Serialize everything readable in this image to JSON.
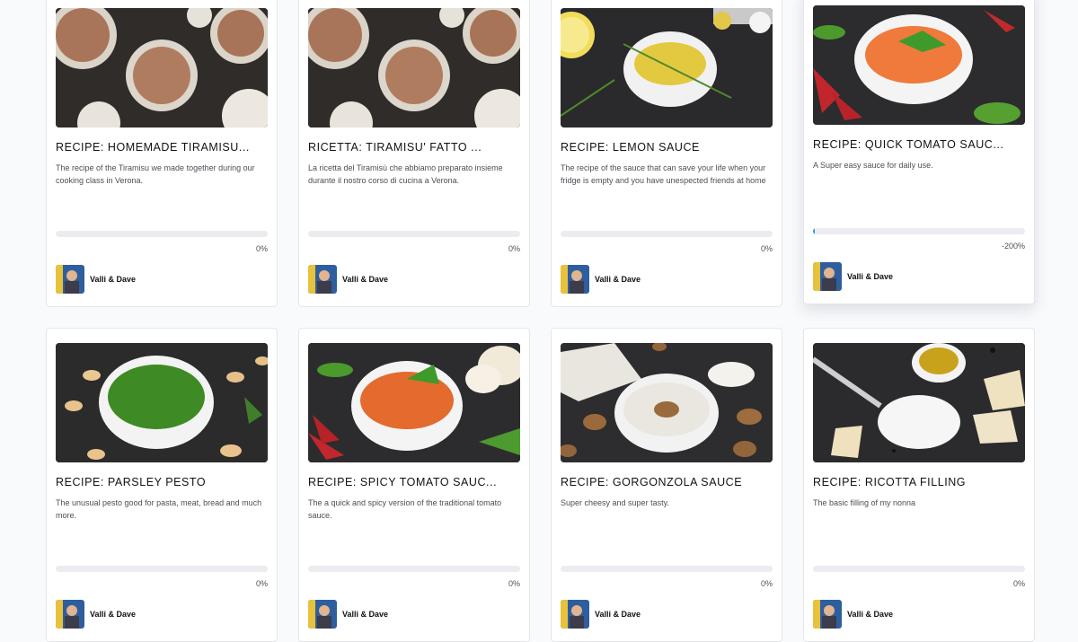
{
  "author": "Valli & Dave",
  "colors": {
    "progress_track": "#ececf0",
    "progress_fill": "#1f9ee8",
    "card_border": "#e4e6eb"
  },
  "recipes": [
    {
      "title": "RECIPE: HOMEMADE TIRAMISU...",
      "description": "The recipe of the Tiramisu we made together during our cooking class in Verona.",
      "progress_label": "0%",
      "progress_value": 0,
      "image": "tiramisu-jars"
    },
    {
      "title": "RICETTA: TIRAMISU' FATTO ...",
      "description": "La ricetta del Tiramisù che abbiamo preparato insieme durante il nostro corso di cucina a Verona.",
      "progress_label": "0%",
      "progress_value": 0,
      "image": "tiramisu-jars"
    },
    {
      "title": "RECIPE: LEMON SAUCE",
      "description": "The recipe of the sauce that can save your life when your fridge is empty and you have unespected friends at home",
      "progress_label": "0%",
      "progress_value": 0,
      "image": "lemon-sauce-bowl"
    },
    {
      "title": "RECIPE: QUICK TOMATO SAUC...",
      "description": "A Super easy sauce for daily use.",
      "progress_label": "-200%",
      "progress_value": -2,
      "image": "tomato-sauce-bowl"
    },
    {
      "title": "RECIPE: PARSLEY PESTO",
      "description": "The unusual pesto good for pasta, meat, bread and much more.",
      "progress_label": "0%",
      "progress_value": 0,
      "image": "parsley-pesto-bowl"
    },
    {
      "title": "RECIPE: SPICY TOMATO SAUC...",
      "description": "The a quick and spicy version of the traditional tomato sauce.",
      "progress_label": "0%",
      "progress_value": 0,
      "image": "spicy-tomato-bowl"
    },
    {
      "title": "RECIPE: GORGONZOLA SAUCE",
      "description": "Super cheesy and super tasty.",
      "progress_label": "0%",
      "progress_value": 0,
      "image": "gorgonzola-sauce-bowl"
    },
    {
      "title": "RECIPE: RICOTTA FILLING",
      "description": "The basic filling of my nonna",
      "progress_label": "0%",
      "progress_value": 0,
      "image": "ricotta-cheese"
    }
  ]
}
